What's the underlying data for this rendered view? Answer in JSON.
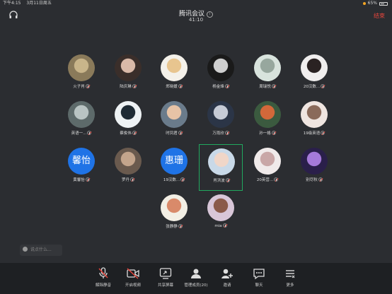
{
  "status_bar": {
    "time": "下午4:15",
    "date": "3月11日周五",
    "battery": "65%"
  },
  "meeting": {
    "title": "腾讯会议",
    "timer": "41:10",
    "end_label": "结束"
  },
  "participants": [
    {
      "name": "火子肖",
      "avatar": {
        "type": "photo",
        "bg": "#8a7a5a",
        "fg": "#c9b58a"
      }
    },
    {
      "name": "陆庆琳",
      "avatar": {
        "type": "photo",
        "bg": "#3a2e2a",
        "fg": "#d9b9a8"
      }
    },
    {
      "name": "郑晓媛",
      "avatar": {
        "type": "photo",
        "bg": "#f4f1ea",
        "fg": "#e8c58f"
      }
    },
    {
      "name": "杨金烽",
      "avatar": {
        "type": "photo",
        "bg": "#1a1a1a",
        "fg": "#cfcfcf"
      }
    },
    {
      "name": "周瑞悦",
      "avatar": {
        "type": "photo",
        "bg": "#d8e3dd",
        "fg": "#97a79e"
      }
    },
    {
      "name": "20汉数...",
      "avatar": {
        "type": "photo",
        "bg": "#f0eeee",
        "fg": "#2a2222"
      }
    },
    {
      "name": "英语一...",
      "avatar": {
        "type": "photo",
        "bg": "#5d6a6a",
        "fg": "#b9c4c3"
      }
    },
    {
      "name": "蔡俊伟",
      "avatar": {
        "type": "photo",
        "bg": "#eef2f4",
        "fg": "#1f2b35"
      }
    },
    {
      "name": "时凤君",
      "avatar": {
        "type": "photo",
        "bg": "#6a7b8b",
        "fg": "#e7c3a6"
      }
    },
    {
      "name": "万雨欣",
      "avatar": {
        "type": "photo",
        "bg": "#2b3547",
        "fg": "#c6cbd6"
      }
    },
    {
      "name": "孙一格",
      "avatar": {
        "type": "photo",
        "bg": "#3b5a3f",
        "fg": "#d2683a"
      }
    },
    {
      "name": "19级英语",
      "avatar": {
        "type": "photo",
        "bg": "#efe5e0",
        "fg": "#8a6a5a"
      }
    },
    {
      "name": "黄馨怡",
      "avatar": {
        "type": "text",
        "text": "馨怡"
      }
    },
    {
      "name": "罗丹",
      "avatar": {
        "type": "photo",
        "bg": "#6a5a4e",
        "fg": "#c4a58c"
      }
    },
    {
      "name": "19汉数...",
      "avatar": {
        "type": "text",
        "text": "惠珊"
      }
    },
    {
      "name": "肖洪波",
      "avatar": {
        "type": "photo",
        "bg": "#c9d9e8",
        "fg": "#f0d6c8"
      }
    },
    {
      "name": "20英营...",
      "avatar": {
        "type": "photo",
        "bg": "#f0eaea",
        "fg": "#c9a7a7"
      }
    },
    {
      "name": "别尽秋",
      "avatar": {
        "type": "photo",
        "bg": "#2a1f4a",
        "fg": "#a57ad9"
      }
    },
    {
      "name": "张静静",
      "avatar": {
        "type": "photo",
        "bg": "#f3efe5",
        "fg": "#d98a6a"
      }
    },
    {
      "name": "mia",
      "avatar": {
        "type": "photo",
        "bg": "#d8c6d8",
        "fg": "#8a5a4a"
      }
    }
  ],
  "active_speaker": "肖洪波",
  "chat": {
    "placeholder": "说点什么..."
  },
  "toolbar": [
    {
      "label": "解除静音",
      "icon": "mic-muted-icon"
    },
    {
      "label": "开启视频",
      "icon": "video-off-icon"
    },
    {
      "label": "共享屏幕",
      "icon": "share-screen-icon"
    },
    {
      "label": "管理成员(20)",
      "icon": "members-icon"
    },
    {
      "label": "邀请",
      "icon": "invite-icon"
    },
    {
      "label": "聊天",
      "icon": "chat-icon"
    },
    {
      "label": "更多",
      "icon": "more-icon"
    }
  ],
  "colors": {
    "background": "#2b2d31",
    "toolbar": "#1e2023",
    "accent_blue": "#1f73e6",
    "end_red": "#e5453c",
    "active_green": "#21a95f"
  }
}
